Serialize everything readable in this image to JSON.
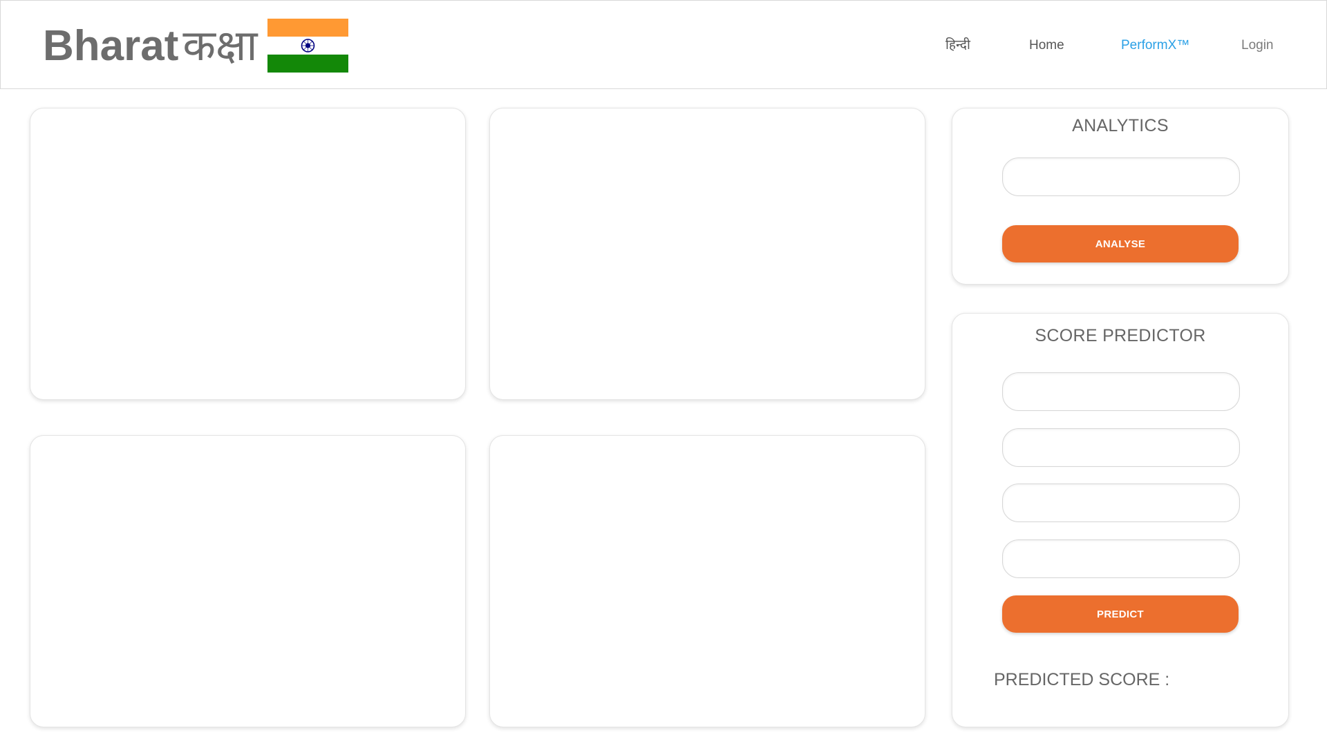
{
  "header": {
    "brand_latin": "Bharat",
    "brand_hindi": "कक्षा",
    "flag": {
      "saffron": "#ff9933",
      "white": "#ffffff",
      "green": "#138808",
      "chakra": "#000080"
    },
    "nav": {
      "hindi": "हिन्दी",
      "home": "Home",
      "performx": "PerformX™",
      "login": "Login"
    }
  },
  "analytics": {
    "title": "ANALYTICS",
    "input_value": "",
    "button_label": "ANALYSE"
  },
  "score_predictor": {
    "title": "SCORE PREDICTOR",
    "inputs": [
      "",
      "",
      "",
      ""
    ],
    "button_label": "PREDICT",
    "result_label": "PREDICTED SCORE :"
  },
  "colors": {
    "accent": "#ec6f2e",
    "active_nav": "#2aa0e6",
    "text_gray": "#666666"
  }
}
